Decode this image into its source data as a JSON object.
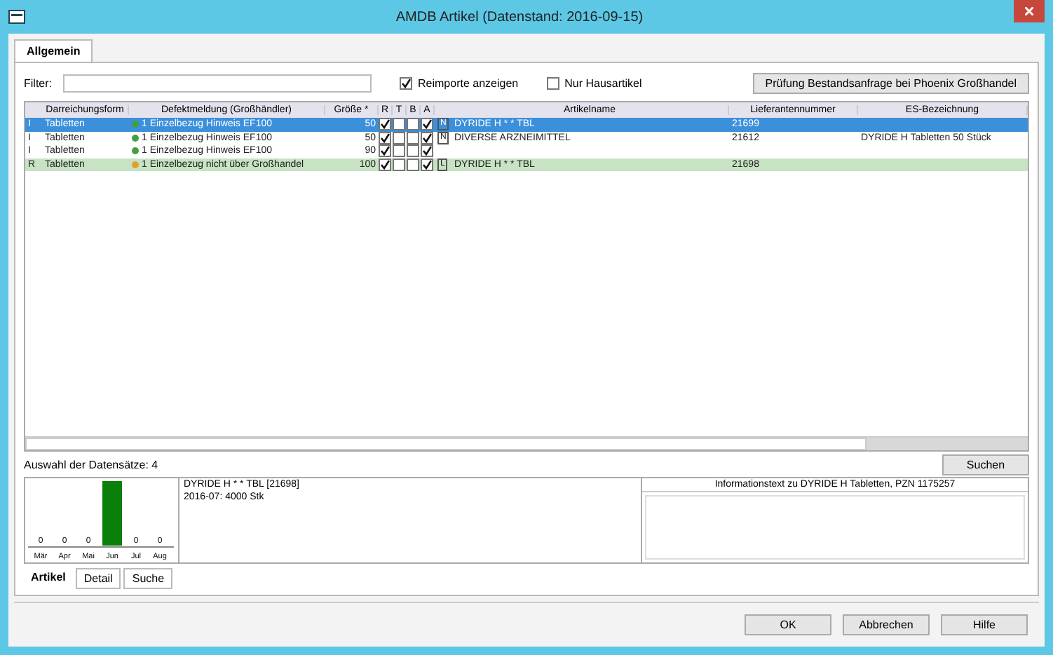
{
  "window": {
    "title": "AMDB Artikel (Datenstand: 2016-09-15)"
  },
  "tabs": [
    {
      "label": "Allgemein",
      "selected": true
    }
  ],
  "filter": {
    "label": "Filter:"
  },
  "options": [
    {
      "label": "Reimporte anzeigen",
      "checked": true
    },
    {
      "label": "Nur Hausartikel",
      "checked": false
    }
  ],
  "check_button": "Prüfung Bestandsanfrage bei Phoenix Großhandel",
  "table": {
    "columns": [
      "Darreichungsform",
      "Defektmeldung (Großhändler)",
      "Größe *",
      "R",
      "T",
      "B",
      "A",
      "Artikelname",
      "Lieferantennummer",
      "ES-Bezeichnung"
    ],
    "rows": [
      {
        "marker": "I",
        "form": "Tabletten",
        "color": "#40a040",
        "status": "1 Einzelbezug Hinweis EF100",
        "size": "50",
        "r": true,
        "t": false,
        "b": false,
        "a": true,
        "tag": "N",
        "name": "DYRIDE H * * TBL",
        "number": "21699",
        "selected": true,
        "highlight": false
      },
      {
        "marker": "I",
        "form": "Tabletten",
        "color": "#40a040",
        "status": "1 Einzelbezug Hinweis EF100",
        "size": "50",
        "r": true,
        "t": false,
        "b": false,
        "a": true,
        "tag": "N",
        "name": "DIVERSE ARZNEIMITTEL",
        "number": "21612",
        "desc": "DYRIDE H Tabletten 50 Stück",
        "selected": false,
        "highlight": false
      },
      {
        "marker": "I",
        "form": "Tabletten",
        "color": "#40a040",
        "status": "1 Einzelbezug Hinweis EF100",
        "size": "90",
        "r": true,
        "t": false,
        "b": false,
        "a": true,
        "selected": false,
        "highlight": false
      },
      {
        "marker": "R",
        "form": "Tabletten",
        "color": "#e0a030",
        "status": "1 Einzelbezug nicht über Großhandel",
        "size": "100",
        "r": true,
        "t": false,
        "b": false,
        "a": true,
        "tag": "L",
        "name": "DYRIDE H * * TBL",
        "number": "21698",
        "selected": false,
        "highlight": true
      }
    ]
  },
  "selection_label": "Auswahl der Datensätze: 4",
  "search_button": "Suchen",
  "detail": {
    "sales_bars": [
      {
        "month": "Mär",
        "label": "0",
        "filled": false
      },
      {
        "month": "Apr",
        "label": "0",
        "filled": false
      },
      {
        "month": "Mai",
        "label": "0",
        "filled": false
      },
      {
        "month": "Jun",
        "filled": true
      },
      {
        "month": "Jul",
        "label": "0",
        "filled": false
      },
      {
        "month": "Aug",
        "label": "0",
        "filled": false
      }
    ],
    "article": "DYRIDE H * * TBL [21698]",
    "history": "2016-07: 4000 Stk",
    "info_title": "Informationstext zu DYRIDE H Tabletten, PZN 1175257"
  },
  "bottom_tabs": [
    {
      "label": "Artikel",
      "selected": true
    },
    {
      "label": "Detail",
      "selected": false
    },
    {
      "label": "Suche",
      "selected": false
    }
  ],
  "buttons": [
    "OK",
    "Abbrechen",
    "Hilfe"
  ]
}
